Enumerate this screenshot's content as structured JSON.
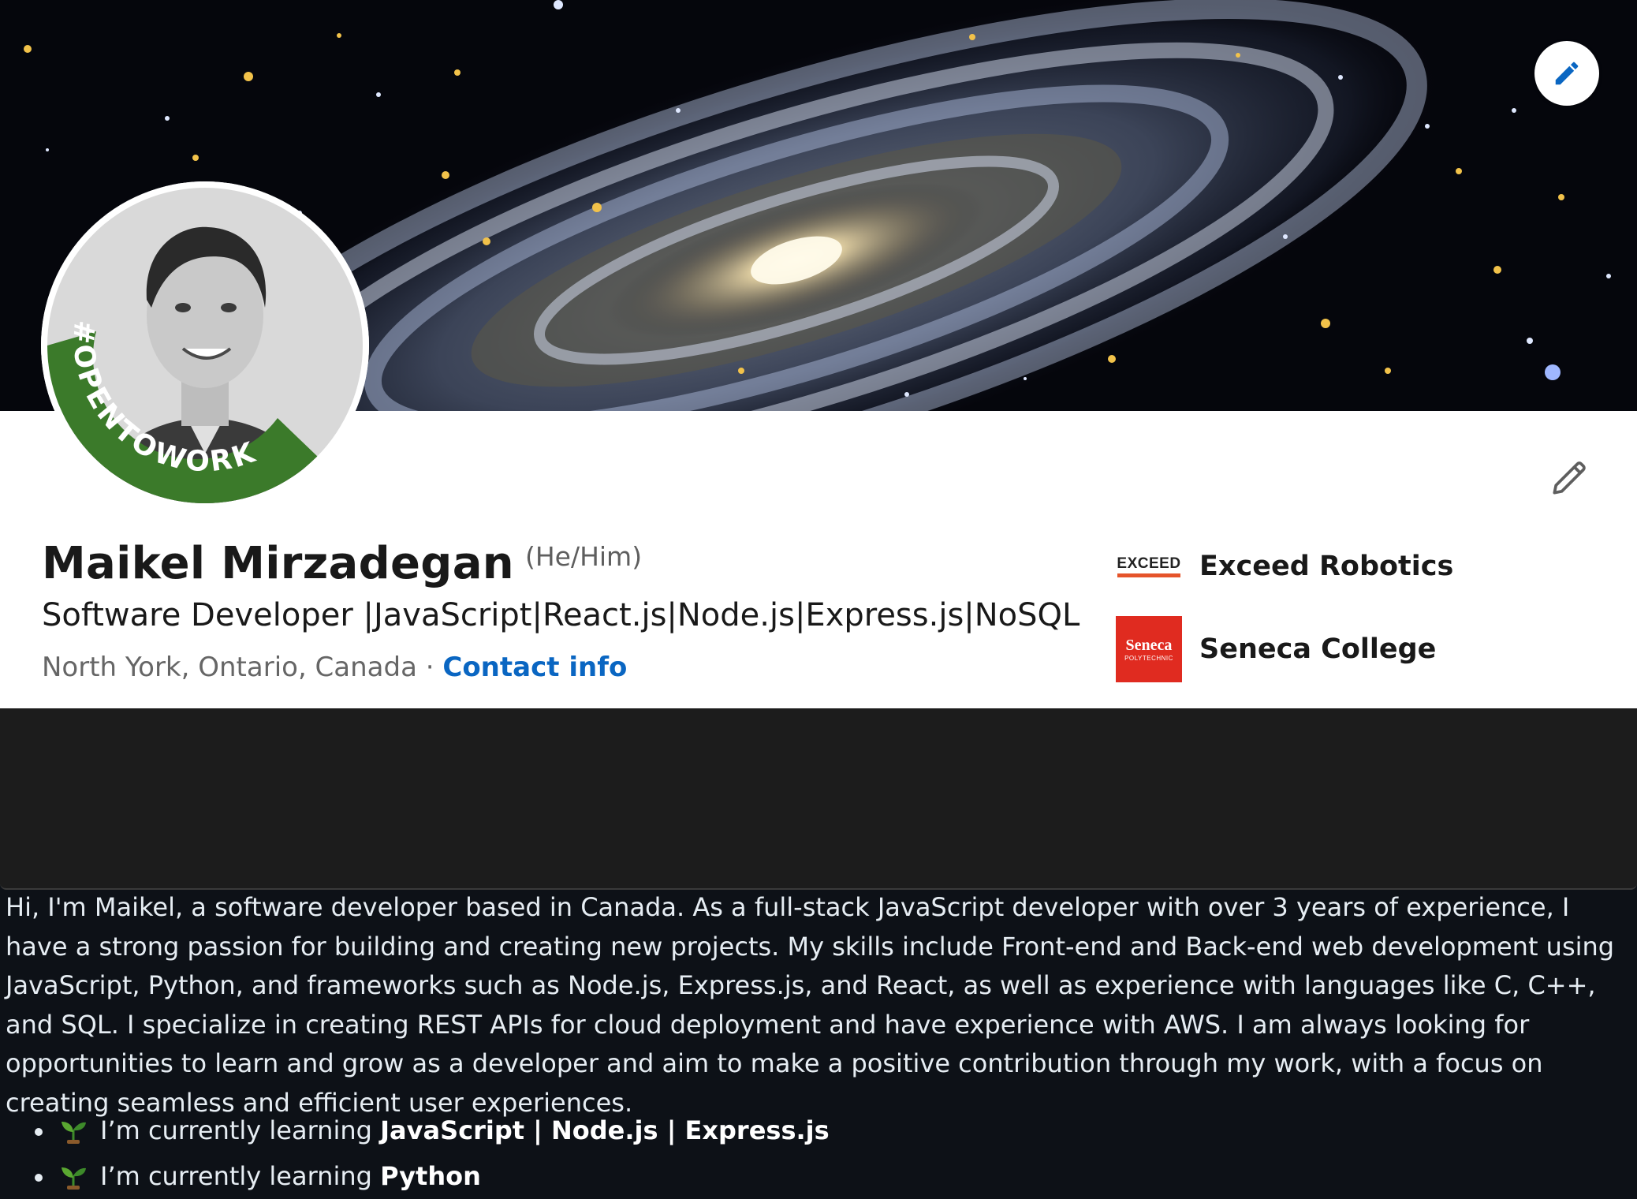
{
  "profile": {
    "name": "Maikel Mirzadegan",
    "pronouns": "(He/Him)",
    "headline": "Software Developer |JavaScript|React.js|Node.js|Express.js|NoSQL",
    "location": "North York, Ontario, Canada",
    "separator": " · ",
    "contact_link": "Contact info",
    "open_to_work_badge": "#OPENTOWORK",
    "icons": {
      "banner_edit": "pencil-icon",
      "intro_edit": "pencil-outline-icon"
    }
  },
  "orgs": [
    {
      "name": "Exceed Robotics",
      "logo_text": "EXCEED"
    },
    {
      "name": "Seneca College",
      "logo_text": "Seneca",
      "logo_subtext": "POLYTECHNIC"
    }
  ],
  "readme": {
    "about": "Hi, I'm Maikel, a software developer based in Canada. As a full-stack JavaScript developer with over 3 years of experience, I have a strong passion for building and creating new projects. My skills include Front-end and Back-end web development using JavaScript, Python, and frameworks such as Node.js, Express.js, and React, as well as experience with languages like C, C++, and SQL. I specialize in creating REST APIs for cloud deployment and have experience with AWS. I am always looking for opportunities to learn and grow as a developer and aim to make a positive contribution through my work, with a focus on creating seamless and efficient user experiences.",
    "learning": [
      {
        "prefix": "I’m currently learning ",
        "topic": "JavaScript | Node.js | Express.js",
        "icon": "sprout-emoji"
      },
      {
        "prefix": "I’m currently learning ",
        "topic": "Python",
        "icon": "sprout-emoji"
      }
    ]
  },
  "colors": {
    "link": "#0a66c2",
    "open_to_work_green": "#3b7a2a",
    "seneca_red": "#e02b20",
    "readme_bg": "#0d1117",
    "readme_text": "#e6edf3"
  }
}
